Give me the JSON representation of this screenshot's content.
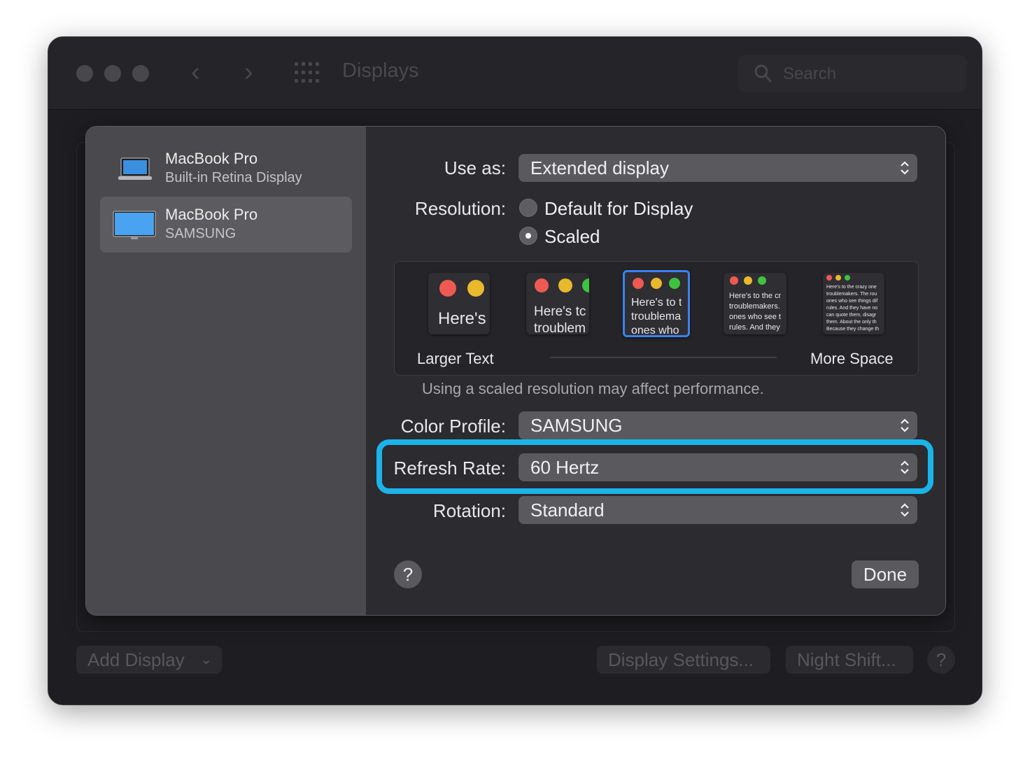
{
  "window": {
    "title": "Displays",
    "search_placeholder": "Search"
  },
  "sidebar": {
    "items": [
      {
        "title": "MacBook Pro",
        "subtitle": "Built-in Retina Display",
        "icon": "laptop-icon",
        "selected": false
      },
      {
        "title": "MacBook Pro",
        "subtitle": "SAMSUNG",
        "icon": "monitor-icon",
        "selected": true
      }
    ]
  },
  "settings": {
    "use_as_label": "Use as:",
    "use_as_value": "Extended display",
    "resolution_label": "Resolution:",
    "resolution_options": [
      {
        "label": "Default for Display",
        "selected": false
      },
      {
        "label": "Scaled",
        "selected": true
      }
    ],
    "scale_options": [
      {
        "text": "Here's",
        "selected": false
      },
      {
        "text": "Here's tc\ntroublem",
        "selected": false
      },
      {
        "text": "Here's to t\ntroublema\nones who",
        "selected": true
      },
      {
        "text": "Here's to the cr\ntroublemakers.\nones who see t\nrules. And they",
        "selected": false
      },
      {
        "text": "Here's to the crazy one\ntroublemakers. The rou\nones who see things dif\nrules. And they have no\ncan quote them, disagr\nthem. About the only th\nBecause they change th",
        "selected": false
      }
    ],
    "scale_left_label": "Larger Text",
    "scale_right_label": "More Space",
    "scaled_hint": "Using a scaled resolution may affect performance.",
    "color_profile_label": "Color Profile:",
    "color_profile_value": "SAMSUNG",
    "refresh_rate_label": "Refresh Rate:",
    "refresh_rate_value": "60 Hertz",
    "rotation_label": "Rotation:",
    "rotation_value": "Standard",
    "help_label": "?",
    "done_label": "Done"
  },
  "bottom": {
    "add_display": "Add Display",
    "display_settings": "Display Settings...",
    "night_shift": "Night Shift...",
    "help": "?"
  },
  "colors": {
    "highlight": "#1ab4e8",
    "selected_thumb": "#3b82f0",
    "traffic_red": "#ee5a52",
    "traffic_yellow": "#e8b92c",
    "traffic_green": "#3fc240"
  }
}
